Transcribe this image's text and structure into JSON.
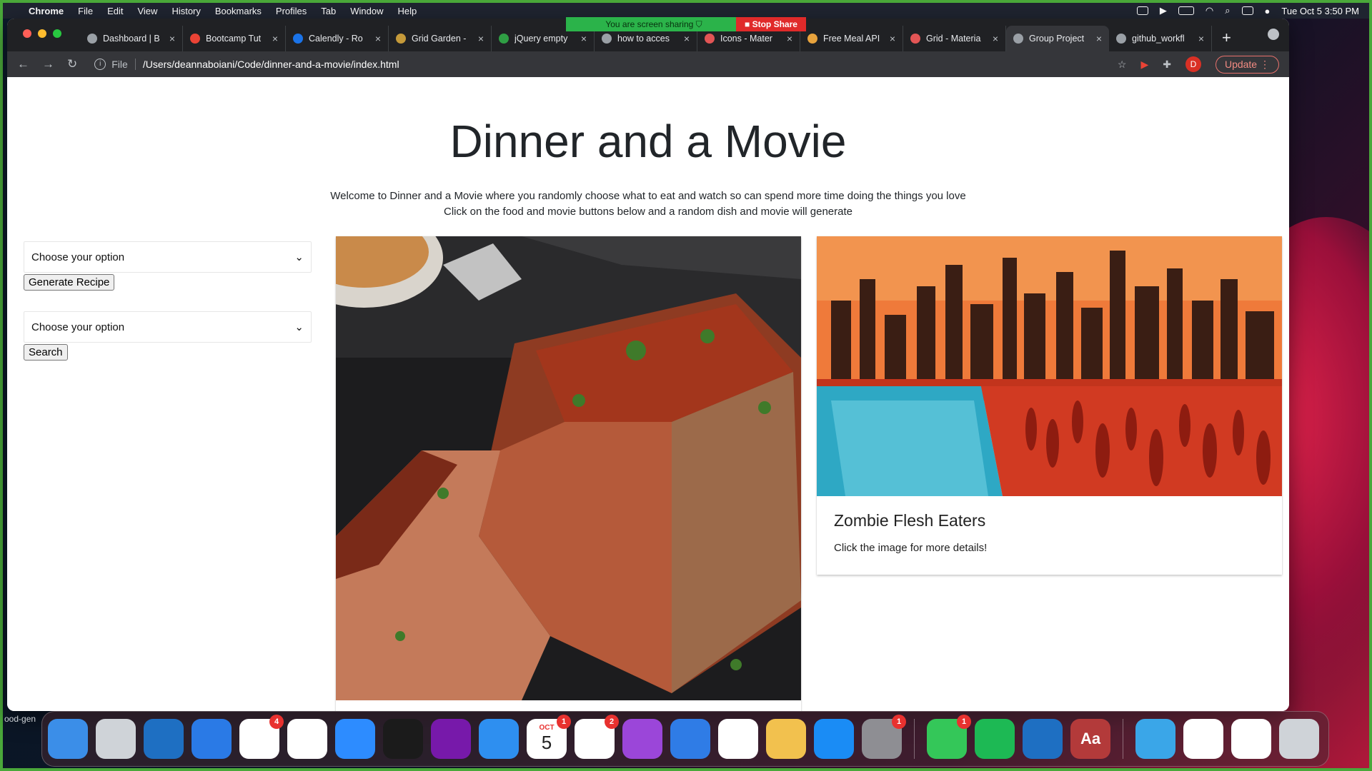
{
  "menubar": {
    "app": "Chrome",
    "items": [
      "File",
      "Edit",
      "View",
      "History",
      "Bookmarks",
      "Profiles",
      "Tab",
      "Window",
      "Help"
    ],
    "datetime": "Tue Oct 5  3:50 PM"
  },
  "sharing": {
    "status": "You are screen sharing",
    "stop_label": "Stop Share"
  },
  "tabs": [
    {
      "title": "Dashboard | B",
      "fav_color": "#9aa0a6"
    },
    {
      "title": "Bootcamp Tut",
      "fav_color": "#ea4335"
    },
    {
      "title": "Calendly - Ro",
      "fav_color": "#1a73e8"
    },
    {
      "title": "Grid Garden -",
      "fav_color": "#c59a3a"
    },
    {
      "title": "jQuery empty",
      "fav_color": "#2f9e44"
    },
    {
      "title": "how to acces",
      "fav_color": "#9aa0a6"
    },
    {
      "title": "Icons - Mater",
      "fav_color": "#e25555"
    },
    {
      "title": "Free Meal API",
      "fav_color": "#e8a33d"
    },
    {
      "title": "Grid - Materia",
      "fav_color": "#e25555"
    },
    {
      "title": "Group Project",
      "fav_color": "#9aa0a6"
    },
    {
      "title": "github_workfl",
      "fav_color": "#9aa0a6"
    }
  ],
  "active_tab_index": 9,
  "address": {
    "scheme": "File",
    "url": "/Users/deannaboiani/Code/dinner-and-a-movie/index.html"
  },
  "toolbar": {
    "avatar_letter": "D",
    "update_label": "Update"
  },
  "page": {
    "title": "Dinner and a Movie",
    "intro_line1": "Welcome to Dinner and a Movie where you randomly choose what to eat and watch so can spend more time doing the things you love",
    "intro_line2": "Click on the food and movie buttons below and a random dish and movie will generate",
    "food_select": "Choose your option",
    "food_button": "Generate Recipe",
    "movie_select": "Choose your option",
    "movie_button": "Search",
    "movie_card": {
      "title": "Zombie Flesh Eaters",
      "text": "Click the image for more details!"
    }
  },
  "dock": {
    "apps": [
      {
        "name": "finder",
        "color": "#3b8ee8"
      },
      {
        "name": "launchpad",
        "color": "#cfd3d8"
      },
      {
        "name": "vscode",
        "color": "#1e6fc2"
      },
      {
        "name": "xcode",
        "color": "#2a7ae6"
      },
      {
        "name": "slack",
        "color": "#ffffff",
        "badge": "4"
      },
      {
        "name": "chrome",
        "color": "#ffffff"
      },
      {
        "name": "zoom",
        "color": "#2d8cff"
      },
      {
        "name": "terminal",
        "color": "#1b1b1b"
      },
      {
        "name": "onenote",
        "color": "#7719aa"
      },
      {
        "name": "safari",
        "color": "#2e8ff0"
      },
      {
        "name": "calendar",
        "color": "#ffffff",
        "badge": "1",
        "label_month": "OCT",
        "label_day": "5"
      },
      {
        "name": "reminders",
        "color": "#ffffff",
        "badge": "2"
      },
      {
        "name": "podcasts",
        "color": "#9b46d9"
      },
      {
        "name": "keynote",
        "color": "#2f7ce6"
      },
      {
        "name": "numbers",
        "color": "#ffffff"
      },
      {
        "name": "pages",
        "color": "#f2c14e"
      },
      {
        "name": "app-store",
        "color": "#1a8cf5"
      },
      {
        "name": "system-preferences",
        "color": "#8e8e93",
        "badge": "1"
      },
      {
        "name": "messages",
        "color": "#34c759",
        "badge": "1"
      },
      {
        "name": "spotify",
        "color": "#1db954"
      },
      {
        "name": "vscode-2",
        "color": "#1e6fc2"
      },
      {
        "name": "dictionary",
        "color": "#b33a3a",
        "label": "Aa"
      },
      {
        "name": "folder",
        "color": "#3aa6e8"
      },
      {
        "name": "document-1",
        "color": "#ffffff"
      },
      {
        "name": "document-2",
        "color": "#ffffff"
      },
      {
        "name": "trash",
        "color": "#cfd3d8"
      }
    ]
  },
  "side_text": "ood-gen"
}
